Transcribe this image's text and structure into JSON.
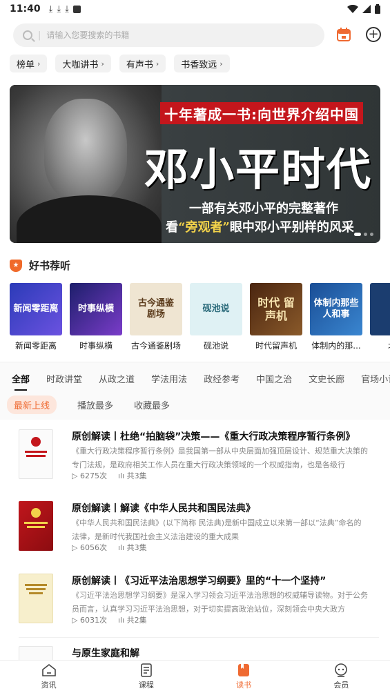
{
  "status": {
    "time": "11:40",
    "left_icons": [
      "download-icon",
      "download-icon",
      "download-icon",
      "a-icon"
    ]
  },
  "search": {
    "placeholder": "请输入您要搜索的书籍",
    "divider": "|"
  },
  "quick_tags": [
    {
      "label": "榜单"
    },
    {
      "label": "大咖讲书"
    },
    {
      "label": "有声书"
    },
    {
      "label": "书香致远"
    }
  ],
  "banner": {
    "red_title": "十年著成一书:向世界介绍中国",
    "big_title": "邓小平时代",
    "subtitle_1": "一部有关邓小平的完整著作",
    "subtitle_2_pre": "看",
    "subtitle_2_hl": "“旁观者”",
    "subtitle_2_post": "眼中邓小平别样的风采"
  },
  "section": {
    "title": "好书荐听"
  },
  "books": [
    {
      "title": "新闻零距离",
      "cover_text": "新闻零距离",
      "color": "#3a4fc4"
    },
    {
      "title": "时事纵横",
      "cover_text": "时事纵横",
      "color": "#2a2f8a"
    },
    {
      "title": "古今通鉴剧场",
      "cover_text": "古今通鉴 剧场",
      "color": "#e9dcc6"
    },
    {
      "title": "砚池说",
      "cover_text": "砚池说",
      "color": "#d6eef2"
    },
    {
      "title": "时代留声机",
      "cover_text": "时代 留声机",
      "color": "#6b3d1c"
    },
    {
      "title": "体制内的那...",
      "cover_text": "体制内那些 人和事",
      "color": "#1c5fa8"
    },
    {
      "title": "北京",
      "cover_text": "北",
      "color": "#1b3d6f"
    }
  ],
  "categories": [
    "全部",
    "时政讲堂",
    "从政之道",
    "学法用法",
    "政经参考",
    "中国之治",
    "文史长廊",
    "官场小说"
  ],
  "sort_tabs": [
    "最新上线",
    "播放最多",
    "收藏最多"
  ],
  "items": [
    {
      "title": "原创解读丨杜绝“拍脑袋”决策——《重大行政决策程序暂行条例》",
      "desc": "《重大行政决策程序暂行条例》是我国第一部从中央层面加强顶层设计、规范重大决策的专门法规，是政府相关工作人员在重大行政决策领域的一个权威指南，也是各级行",
      "plays": "6275次",
      "episodes": "共3集"
    },
    {
      "title": "原创解读丨解读《中华人民共和国民法典》",
      "desc": "《中华人民共和国民法典》(以下简称 民法典)是新中国成立以来第一部以“法典”命名的法律，是新时代我国社会主义法治建设的重大成果",
      "plays": "6056次",
      "episodes": "共3集"
    },
    {
      "title": "原创解读丨《习近平法治思想学习纲要》里的“十一个坚持”",
      "desc": "《习近平法治思想学习纲要》是深入学习领会习近平法治思想的权威辅导读物。对于公务员而言，认真学习习近平法治思想，对于切实提高政治站位，深刻领会中央大政方",
      "plays": "6031次",
      "episodes": "共2集"
    },
    {
      "title": "与原生家庭和解",
      "desc": "",
      "plays": "",
      "episodes": ""
    }
  ],
  "nav": [
    {
      "label": "资讯",
      "icon": "home-icon"
    },
    {
      "label": "课程",
      "icon": "list-icon"
    },
    {
      "label": "读书",
      "icon": "book-icon"
    },
    {
      "label": "会员",
      "icon": "member-icon"
    }
  ],
  "colors": {
    "accent": "#ef6a32",
    "banner_red": "#c4161c",
    "highlight": "#f3d34a"
  }
}
